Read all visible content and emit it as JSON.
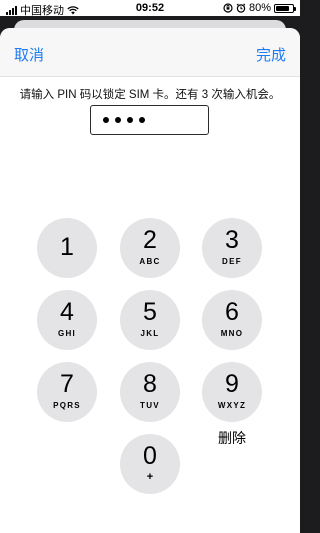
{
  "status_bar": {
    "carrier": "中国移动",
    "time": "09:52",
    "battery_percent": "80%",
    "battery_level": 0.8
  },
  "nav": {
    "cancel_label": "取消",
    "done_label": "完成"
  },
  "prompt": "请输入 PIN 码以锁定 SIM 卡。还有 3 次输入机会。",
  "pin_entered_count": 4,
  "keypad": {
    "keys": [
      {
        "digit": "1",
        "letters": ""
      },
      {
        "digit": "2",
        "letters": "ABC"
      },
      {
        "digit": "3",
        "letters": "DEF"
      },
      {
        "digit": "4",
        "letters": "GHI"
      },
      {
        "digit": "5",
        "letters": "JKL"
      },
      {
        "digit": "6",
        "letters": "MNO"
      },
      {
        "digit": "7",
        "letters": "PQRS"
      },
      {
        "digit": "8",
        "letters": "TUV"
      },
      {
        "digit": "9",
        "letters": "WXYZ"
      },
      {
        "digit": "0",
        "letters": "+"
      }
    ],
    "delete_label": "删除"
  }
}
